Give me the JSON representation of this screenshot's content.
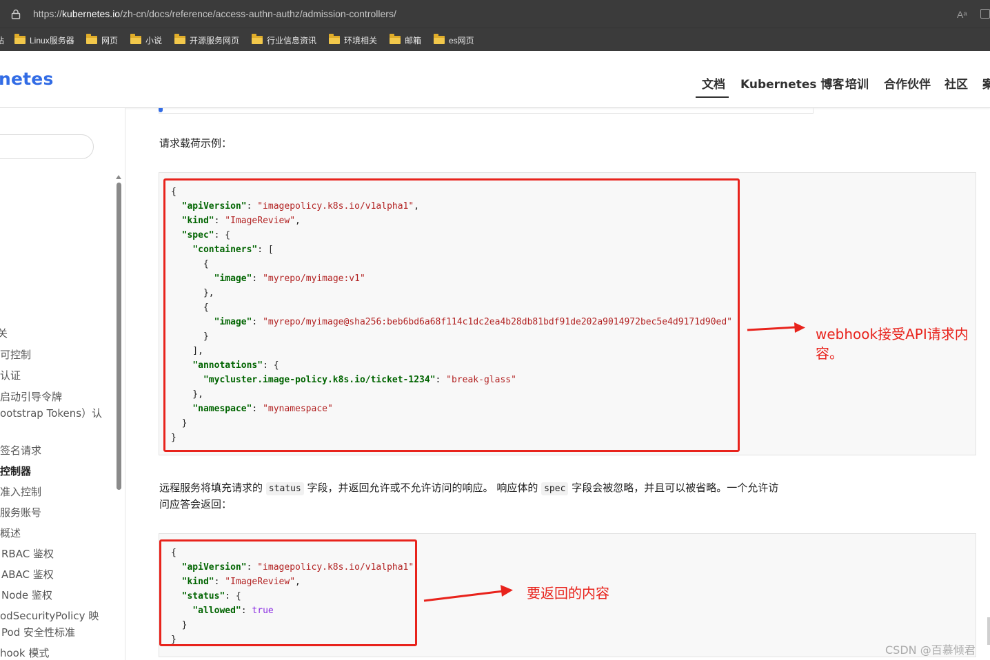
{
  "browser": {
    "url_prefix": "https://",
    "url_host": "kubernetes.io",
    "url_path": "/zh-cn/docs/reference/access-authn-authz/admission-controllers/",
    "read_aloud_label": "Aᵃ"
  },
  "bookmarks": [
    {
      "label": "站",
      "folder": false
    },
    {
      "label": "Linux服务器",
      "folder": true
    },
    {
      "label": "网页",
      "folder": true
    },
    {
      "label": "小说",
      "folder": true
    },
    {
      "label": "开源服务网页",
      "folder": true
    },
    {
      "label": "行业信息资讯",
      "folder": true
    },
    {
      "label": "环境相关",
      "folder": true
    },
    {
      "label": "邮箱",
      "folder": true
    },
    {
      "label": "es网页",
      "folder": true
    }
  ],
  "header": {
    "logo": "netes",
    "nav": [
      "文档",
      "Kubernetes 博客",
      "培训",
      "合作伙伴",
      "社区",
      "案"
    ]
  },
  "sidebar": {
    "items": [
      {
        "label": "关",
        "active": false
      },
      {
        "label": "可控制",
        "active": false
      },
      {
        "label": "认证",
        "active": false
      },
      {
        "label": "启动引导令牌",
        "active": false
      },
      {
        "label": "ootstrap Tokens）认",
        "active": false
      },
      {
        "label": "签名请求",
        "active": false
      },
      {
        "label": "控制器",
        "active": true
      },
      {
        "label": "准入控制",
        "active": false
      },
      {
        "label": "服务账号",
        "active": false
      },
      {
        "label": "概述",
        "active": false
      },
      {
        "label": "RBAC 鉴权",
        "active": false
      },
      {
        "label": "ABAC 鉴权",
        "active": false
      },
      {
        "label": "Node 鉴权",
        "active": false
      },
      {
        "label": "odSecurityPolicy 映",
        "active": false
      },
      {
        "label": "Pod 安全性标准",
        "active": false
      },
      {
        "label": "hook 模式",
        "active": false
      }
    ]
  },
  "content": {
    "request_heading": "请求载荷示例：",
    "response_para": {
      "p1": "远程服务将填充请求的",
      "code1": "status",
      "p2": "字段，并返回允许或不允许访问的响应。 响应体的",
      "code2": "spec",
      "p3": "字段会被忽略，并且可以被省略。一个允许访",
      "p4": "问应答会返回："
    }
  },
  "code_request": [
    [
      {
        "t": "{",
        "k": "p"
      }
    ],
    [
      {
        "t": "  ",
        "k": "p"
      },
      {
        "t": "\"apiVersion\"",
        "k": "key"
      },
      {
        "t": ": ",
        "k": "p"
      },
      {
        "t": "\"imagepolicy.k8s.io/v1alpha1\"",
        "k": "str"
      },
      {
        "t": ",",
        "k": "p"
      }
    ],
    [
      {
        "t": "  ",
        "k": "p"
      },
      {
        "t": "\"kind\"",
        "k": "key"
      },
      {
        "t": ": ",
        "k": "p"
      },
      {
        "t": "\"ImageReview\"",
        "k": "str"
      },
      {
        "t": ",",
        "k": "p"
      }
    ],
    [
      {
        "t": "  ",
        "k": "p"
      },
      {
        "t": "\"spec\"",
        "k": "key"
      },
      {
        "t": ": {",
        "k": "p"
      }
    ],
    [
      {
        "t": "    ",
        "k": "p"
      },
      {
        "t": "\"containers\"",
        "k": "key"
      },
      {
        "t": ": [",
        "k": "p"
      }
    ],
    [
      {
        "t": "      {",
        "k": "p"
      }
    ],
    [
      {
        "t": "        ",
        "k": "p"
      },
      {
        "t": "\"image\"",
        "k": "key"
      },
      {
        "t": ": ",
        "k": "p"
      },
      {
        "t": "\"myrepo/myimage:v1\"",
        "k": "str"
      }
    ],
    [
      {
        "t": "      },",
        "k": "p"
      }
    ],
    [
      {
        "t": "      {",
        "k": "p"
      }
    ],
    [
      {
        "t": "        ",
        "k": "p"
      },
      {
        "t": "\"image\"",
        "k": "key"
      },
      {
        "t": ": ",
        "k": "p"
      },
      {
        "t": "\"myrepo/myimage@sha256:beb6bd6a68f114c1dc2ea4b28db81bdf91de202a9014972bec5e4d9171d90ed\"",
        "k": "str"
      }
    ],
    [
      {
        "t": "      }",
        "k": "p"
      }
    ],
    [
      {
        "t": "    ],",
        "k": "p"
      }
    ],
    [
      {
        "t": "    ",
        "k": "p"
      },
      {
        "t": "\"annotations\"",
        "k": "key"
      },
      {
        "t": ": {",
        "k": "p"
      }
    ],
    [
      {
        "t": "      ",
        "k": "p"
      },
      {
        "t": "\"mycluster.image-policy.k8s.io/ticket-1234\"",
        "k": "key"
      },
      {
        "t": ": ",
        "k": "p"
      },
      {
        "t": "\"break-glass\"",
        "k": "str"
      }
    ],
    [
      {
        "t": "    },",
        "k": "p"
      }
    ],
    [
      {
        "t": "    ",
        "k": "p"
      },
      {
        "t": "\"namespace\"",
        "k": "key"
      },
      {
        "t": ": ",
        "k": "p"
      },
      {
        "t": "\"mynamespace\"",
        "k": "str"
      }
    ],
    [
      {
        "t": "  }",
        "k": "p"
      }
    ],
    [
      {
        "t": "}",
        "k": "p"
      }
    ]
  ],
  "code_response": [
    [
      {
        "t": "{",
        "k": "p"
      }
    ],
    [
      {
        "t": "  ",
        "k": "p"
      },
      {
        "t": "\"apiVersion\"",
        "k": "key"
      },
      {
        "t": ": ",
        "k": "p"
      },
      {
        "t": "\"imagepolicy.k8s.io/v1alpha1\"",
        "k": "str"
      },
      {
        "t": ",",
        "k": "p"
      }
    ],
    [
      {
        "t": "  ",
        "k": "p"
      },
      {
        "t": "\"kind\"",
        "k": "key"
      },
      {
        "t": ": ",
        "k": "p"
      },
      {
        "t": "\"ImageReview\"",
        "k": "str"
      },
      {
        "t": ",",
        "k": "p"
      }
    ],
    [
      {
        "t": "  ",
        "k": "p"
      },
      {
        "t": "\"status\"",
        "k": "key"
      },
      {
        "t": ": {",
        "k": "p"
      }
    ],
    [
      {
        "t": "    ",
        "k": "p"
      },
      {
        "t": "\"allowed\"",
        "k": "key"
      },
      {
        "t": ": ",
        "k": "p"
      },
      {
        "t": "true",
        "k": "kw"
      }
    ],
    [
      {
        "t": "  }",
        "k": "p"
      }
    ],
    [
      {
        "t": "}",
        "k": "p"
      }
    ]
  ],
  "annotations": {
    "request": "webhook接受API请求内容。",
    "response": "要返回的内容",
    "color": "#e8231c"
  },
  "watermark": "CSDN @百慕倾君"
}
